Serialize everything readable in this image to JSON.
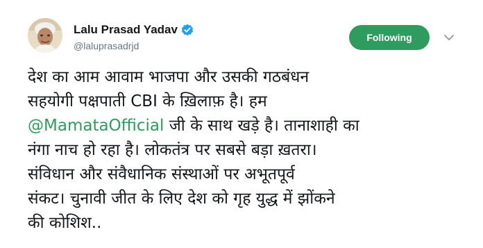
{
  "author": {
    "display_name": "Lalu Prasad Yadav",
    "handle": "@laluprasadrjd",
    "verified": true,
    "avatar_icon": "profile-photo"
  },
  "follow_button": {
    "label": "Following",
    "color": "#2e9b5f"
  },
  "more_menu_icon": "chevron-down-icon",
  "tweet": {
    "line1": "देश का आम आवाम भाजपा और उसकी गठबंधन",
    "line2": "सहयोगी पक्षपाती CBI के ख़िलाफ़ है। हम",
    "mention": "@MamataOfficial",
    "line3_rest": " जी के साथ खड़े है। तानाशाही का",
    "line4": "नंगा नाच हो रहा है। लोकतंत्र पर सबसे बड़ा ख़तरा।",
    "line5": "संविधान और संवैधानिक संस्थाओं पर अभूतपूर्व",
    "line6": "संकट। चुनावी जीत के लिए देश को गृह युद्ध में झोंकने",
    "line7": "की कोशिश.."
  },
  "colors": {
    "text": "#14171a",
    "secondary": "#657786",
    "accent": "#2e9b5f",
    "verified_badge": "#1da1f2"
  }
}
